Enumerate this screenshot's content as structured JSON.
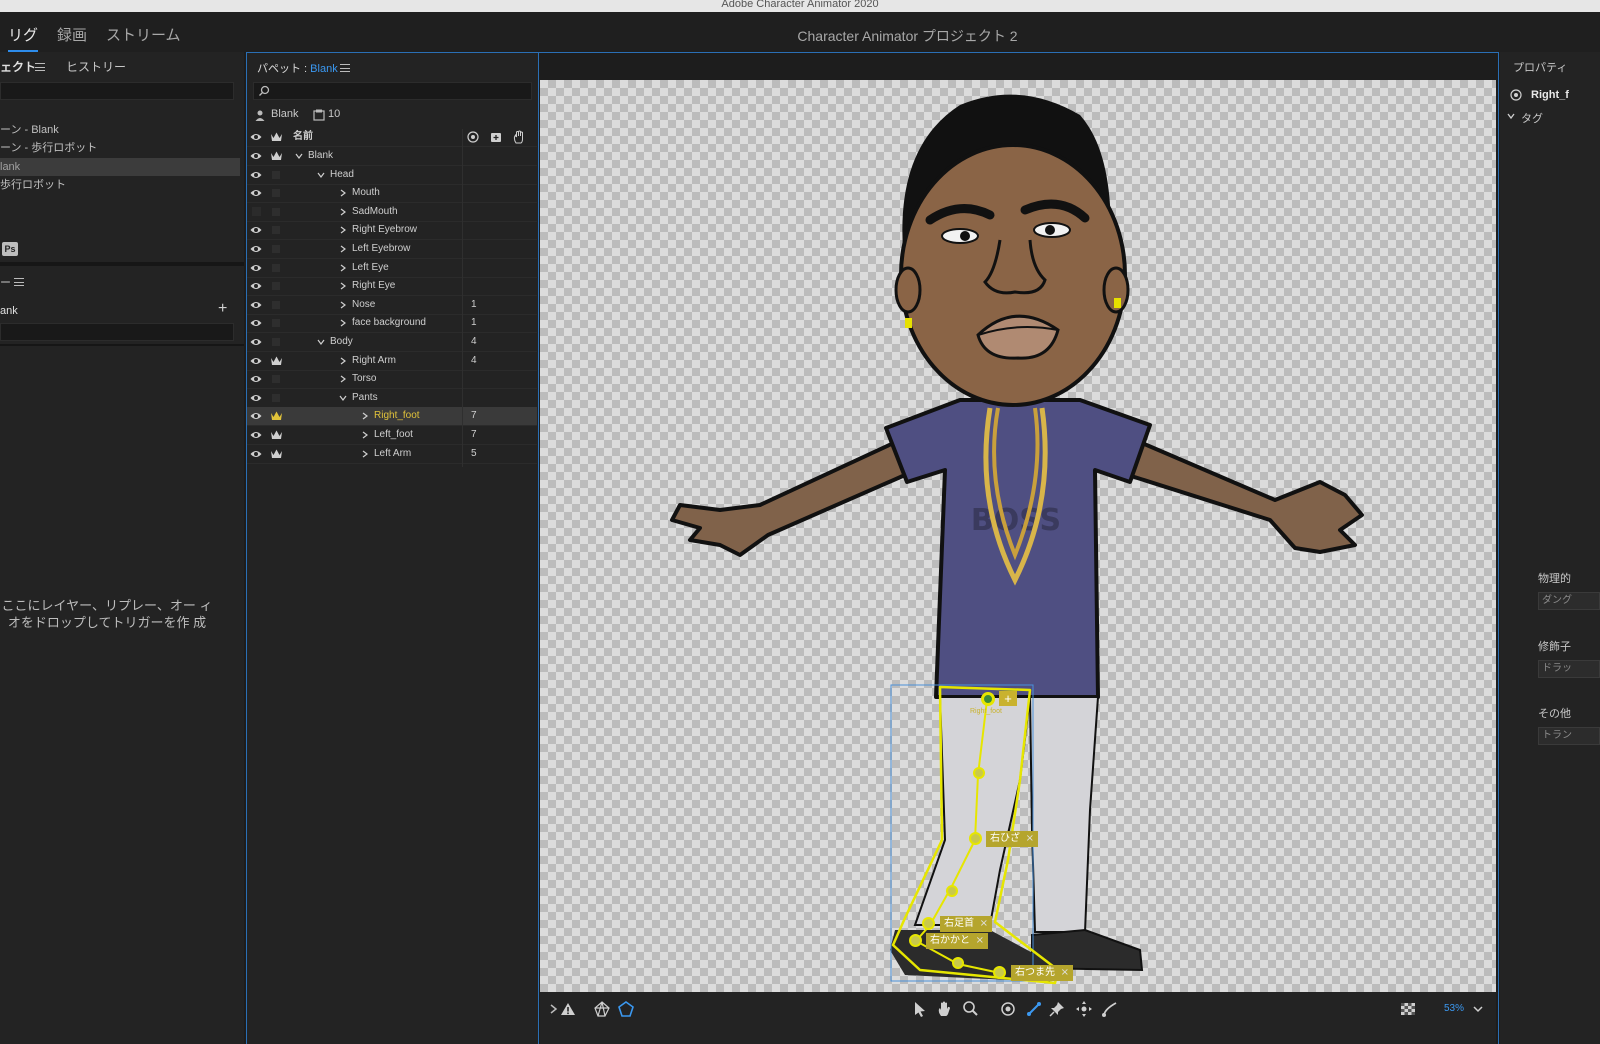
{
  "window": {
    "title": "Adobe Character Animator 2020"
  },
  "modes": [
    {
      "label": "リグ",
      "active": true
    },
    {
      "label": "録画",
      "active": false
    },
    {
      "label": "ストリーム",
      "active": false
    }
  ],
  "project_title": "Character Animator プロジェクト 2",
  "left_panel": {
    "tab_project": "ェクト",
    "tab_history": "ヒストリー",
    "items": [
      {
        "label": "ーン - Blank",
        "selected": false
      },
      {
        "label": "ーン - 歩行ロボット",
        "selected": false
      },
      {
        "label": "lank",
        "selected": true
      },
      {
        "label": "歩行ロボット",
        "selected": false
      }
    ],
    "ps_badge": "Ps",
    "triggers_header": "ー",
    "puppet_label": "ank",
    "add_symbol": "+",
    "drop_message": "ここにレイヤー、リプレー、オー ィオをドロップしてトリガーを作 成"
  },
  "puppet_panel": {
    "title_prefix": "パペット : ",
    "title_name": "Blank",
    "puppet_name": "Blank",
    "count": "10",
    "col_name": "名前",
    "layers": [
      {
        "name": "Blank",
        "depth": 0,
        "expanded": true,
        "crown": true,
        "eye": true,
        "num": ""
      },
      {
        "name": "Head",
        "depth": 1,
        "expanded": true,
        "crown": false,
        "eye": true,
        "num": ""
      },
      {
        "name": "Mouth",
        "depth": 2,
        "expanded": false,
        "crown": false,
        "eye": true,
        "num": ""
      },
      {
        "name": "SadMouth",
        "depth": 2,
        "expanded": false,
        "crown": false,
        "eye": false,
        "num": ""
      },
      {
        "name": "Right Eyebrow",
        "depth": 2,
        "expanded": false,
        "crown": false,
        "eye": true,
        "num": ""
      },
      {
        "name": "Left Eyebrow",
        "depth": 2,
        "expanded": false,
        "crown": false,
        "eye": true,
        "num": ""
      },
      {
        "name": "Left Eye",
        "depth": 2,
        "expanded": false,
        "crown": false,
        "eye": true,
        "num": ""
      },
      {
        "name": "Right Eye",
        "depth": 2,
        "expanded": false,
        "crown": false,
        "eye": true,
        "num": ""
      },
      {
        "name": "Nose",
        "depth": 2,
        "expanded": false,
        "crown": false,
        "eye": true,
        "num": "1"
      },
      {
        "name": "face background",
        "depth": 2,
        "expanded": false,
        "crown": false,
        "eye": true,
        "num": "1"
      },
      {
        "name": "Body",
        "depth": 1,
        "expanded": true,
        "crown": false,
        "eye": true,
        "num": "4"
      },
      {
        "name": "Right Arm",
        "depth": 2,
        "expanded": false,
        "crown": true,
        "eye": true,
        "num": "4"
      },
      {
        "name": "Torso",
        "depth": 2,
        "expanded": false,
        "crown": false,
        "eye": true,
        "num": ""
      },
      {
        "name": "Pants",
        "depth": 2,
        "expanded": true,
        "crown": false,
        "eye": true,
        "num": ""
      },
      {
        "name": "Right_foot",
        "depth": 3,
        "expanded": false,
        "crown": true,
        "eye": true,
        "num": "7",
        "selected": true
      },
      {
        "name": "Left_foot",
        "depth": 3,
        "expanded": false,
        "crown": true,
        "eye": true,
        "num": "7"
      },
      {
        "name": "Left Arm",
        "depth": 3,
        "expanded": false,
        "crown": true,
        "eye": true,
        "num": "5"
      }
    ]
  },
  "canvas": {
    "handle_label": "Right_foot",
    "tags": [
      {
        "label": "右ひざ"
      },
      {
        "label": "右足首"
      },
      {
        "label": "右かかと"
      },
      {
        "label": "右つま先"
      }
    ],
    "shirt_text": "BOSS"
  },
  "toolbar": {
    "zoom": "53%"
  },
  "right_panel": {
    "title": "プロパティ",
    "item": "Right_f",
    "tags_label": "タグ",
    "physics_label": "物理的",
    "physics_btn": "ダング",
    "modifier_label": "修飾子",
    "modifier_btn": "ドラッ",
    "other_label": "その他",
    "other_btn": "トラン"
  },
  "colors": {
    "accent": "#2d8ceb",
    "selected_layer": "#e0c23a",
    "handle": "#e6e600"
  }
}
